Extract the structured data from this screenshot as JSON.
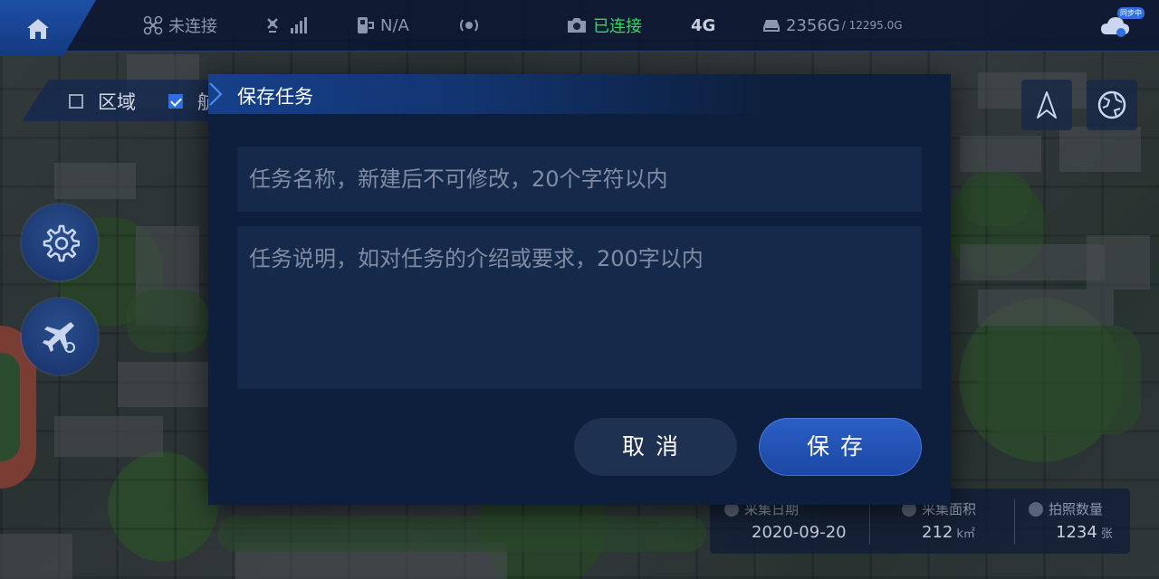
{
  "statusbar": {
    "drone_status": "未连接",
    "sim_value": "N/A",
    "camera_status": "已连接",
    "network": "4G",
    "storage_used": "2356G",
    "storage_total": "/ 12295.0G",
    "sync_badge": "同步中",
    "colors": {
      "connected": "#3cd26b",
      "brand": "#1d4fa6"
    }
  },
  "filters": {
    "region_label": "区域",
    "region_checked": false,
    "second_label": "航",
    "second_checked": true
  },
  "side_buttons": [
    "gear-icon",
    "plane-return-icon"
  ],
  "map_controls": [
    "compass-icon",
    "globe-icon"
  ],
  "stats": {
    "date_label": "采集日期",
    "date_value": "2020-09-20",
    "area_label": "采集面积",
    "area_value": "212",
    "area_unit": "k㎡",
    "count_label": "拍照数量",
    "count_value": "1234",
    "count_unit": "张"
  },
  "dialog": {
    "title": "保存任务",
    "name_placeholder": "任务名称，新建后不可修改，20个字符以内",
    "desc_placeholder": "任务说明，如对任务的介绍或要求，200字以内",
    "cancel_label": "取消",
    "save_label": "保存"
  }
}
